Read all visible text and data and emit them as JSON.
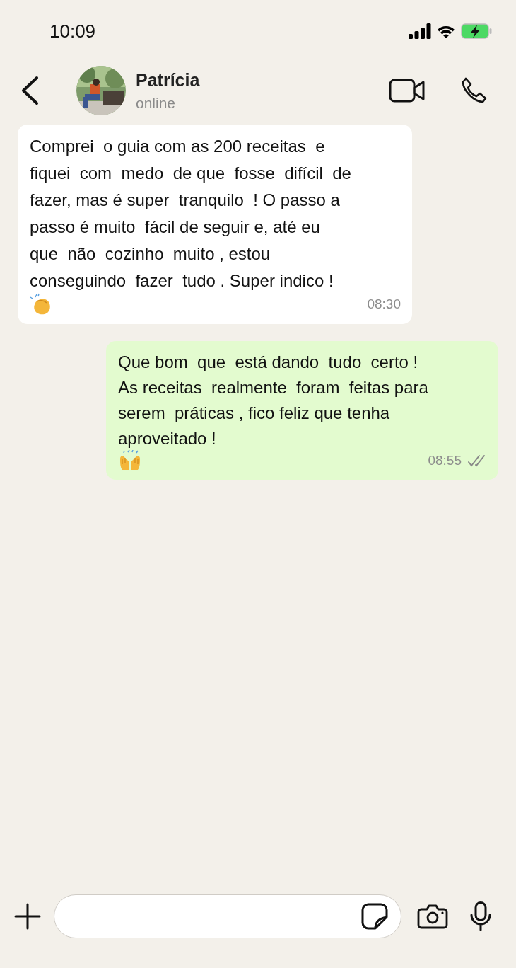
{
  "status_bar": {
    "time": "10:09"
  },
  "header": {
    "name": "Patrícia",
    "status": "online"
  },
  "messages": [
    {
      "kind": "incoming",
      "lines": [
        "Comprei  o guia com as 200 receitas  e",
        "fiquei  com  medo  de que  fosse  difícil  de",
        "fazer, mas é super  tranquilo  ! O passo a",
        "passo é muito  fácil de seguir e, até eu",
        "que  não  cozinho  muito , estou",
        "conseguindo  fazer  tudo . Super indico !"
      ],
      "time": "08:30"
    },
    {
      "kind": "outgoing",
      "lines": [
        "Que bom  que  está dando  tudo  certo !",
        "As receitas  realmente  foram  feitas para",
        "serem  práticas , fico feliz que tenha",
        "aproveitado !"
      ],
      "time": "08:55"
    }
  ]
}
